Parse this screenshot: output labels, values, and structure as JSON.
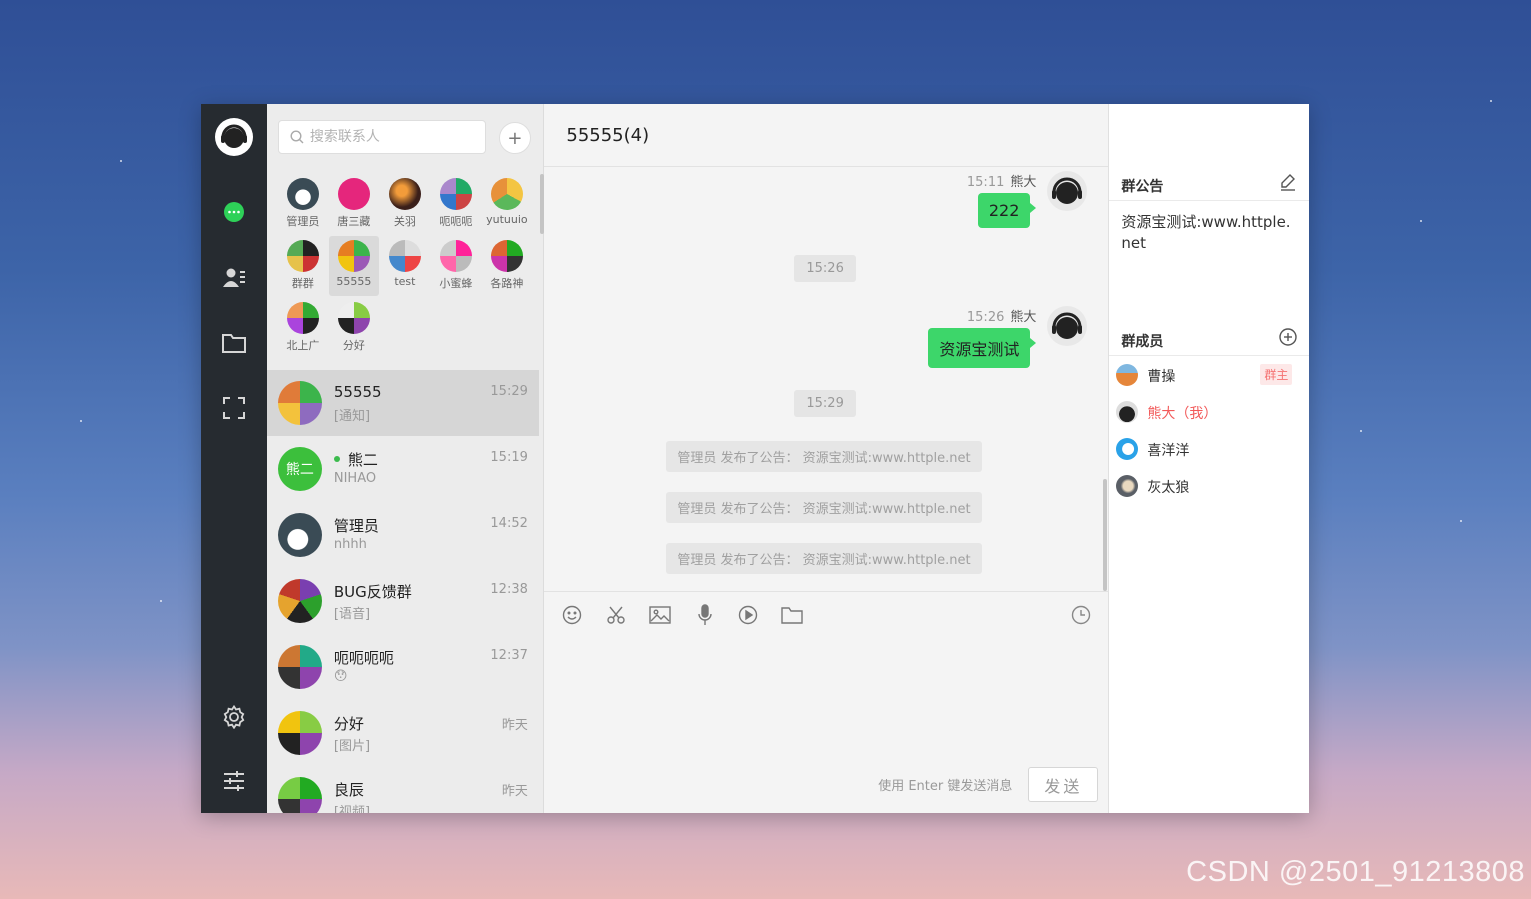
{
  "watermark": "CSDN @2501_91213808",
  "search": {
    "placeholder": "搜索联系人"
  },
  "add_button": "+",
  "groups": [
    {
      "name": "管理员"
    },
    {
      "name": "唐三藏"
    },
    {
      "name": "关羽"
    },
    {
      "name": "呃呃呃"
    },
    {
      "name": "yutuuio"
    },
    {
      "name": "群群"
    },
    {
      "name": "55555"
    },
    {
      "name": "test"
    },
    {
      "name": "小蜜蜂"
    },
    {
      "name": "各路神"
    },
    {
      "name": "北上广"
    },
    {
      "name": "分好"
    }
  ],
  "conversations": [
    {
      "name": "55555",
      "preview": "[通知]",
      "time": "15:29"
    },
    {
      "name": "熊二",
      "preview": "NIHAO",
      "time": "15:19",
      "avatar_text": "熊二"
    },
    {
      "name": "管理员",
      "preview": "nhhh",
      "time": "14:52"
    },
    {
      "name": "BUG反馈群",
      "preview": "[语音]",
      "time": "12:38"
    },
    {
      "name": "呃呃呃呃",
      "preview": "",
      "time": "12:37"
    },
    {
      "name": "分好",
      "preview": "[图片]",
      "time": "昨天"
    },
    {
      "name": "良辰",
      "preview": "[视频]",
      "time": "昨天"
    }
  ],
  "chat": {
    "title": "55555(4)",
    "messages": [
      {
        "time": "15:11",
        "sender": "熊大",
        "text": "222"
      },
      {
        "time": "15:26",
        "sender": "熊大",
        "text": "资源宝测试"
      }
    ],
    "time_chips": [
      "15:26",
      "15:29"
    ],
    "notices": [
      "管理员 发布了公告： 资源宝测试:www.httple.net",
      "管理员 发布了公告： 资源宝测试:www.httple.net",
      "管理员 发布了公告： 资源宝测试:www.httple.net"
    ],
    "hint": "使用 Enter 键发送消息",
    "send_label": "发送"
  },
  "side": {
    "notice_title": "群公告",
    "notice_text": "资源宝测试:www.httple.net",
    "members_title": "群成员",
    "members": [
      {
        "name": "曹操",
        "tag": "群主"
      },
      {
        "name": "熊大（我）"
      },
      {
        "name": "喜洋洋"
      },
      {
        "name": "灰太狼"
      }
    ]
  },
  "colors": {
    "rail": "#262b30",
    "accent_green": "#3dd66a",
    "me_red": "#f25a5a"
  }
}
